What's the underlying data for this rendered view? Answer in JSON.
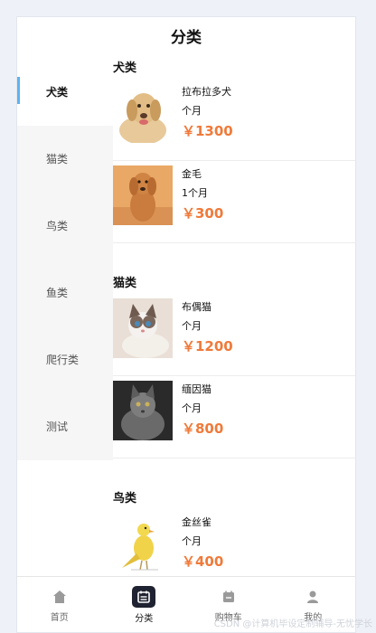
{
  "header": {
    "title": "分类"
  },
  "sidebar": {
    "items": [
      {
        "label": "犬类"
      },
      {
        "label": "猫类"
      },
      {
        "label": "鸟类"
      },
      {
        "label": "鱼类"
      },
      {
        "label": "爬行类"
      },
      {
        "label": "测试"
      }
    ]
  },
  "sections": [
    {
      "title": "犬类",
      "products": [
        {
          "name": "拉布拉多犬",
          "age": "个月",
          "price": "￥1300"
        },
        {
          "name": "金毛",
          "age": "1个月",
          "price": "￥300"
        }
      ]
    },
    {
      "title": "猫类",
      "products": [
        {
          "name": "布偶猫",
          "age": "个月",
          "price": "￥1200"
        },
        {
          "name": "缅因猫",
          "age": "个月",
          "price": "￥800"
        }
      ]
    },
    {
      "title": "鸟类",
      "products": [
        {
          "name": "金丝雀",
          "age": "个月",
          "price": "￥400"
        }
      ]
    }
  ],
  "tabbar": {
    "items": [
      {
        "label": "首页",
        "icon": "home-icon"
      },
      {
        "label": "分类",
        "icon": "category-icon"
      },
      {
        "label": "购物车",
        "icon": "cart-icon"
      },
      {
        "label": "我的",
        "icon": "user-icon"
      }
    ]
  },
  "watermark": "CSDN @计算机毕设定制辅导-无忧学长",
  "colors": {
    "accent": "#5ab4f0",
    "price": "#f07a3a",
    "active_tab": "#1f2230"
  }
}
